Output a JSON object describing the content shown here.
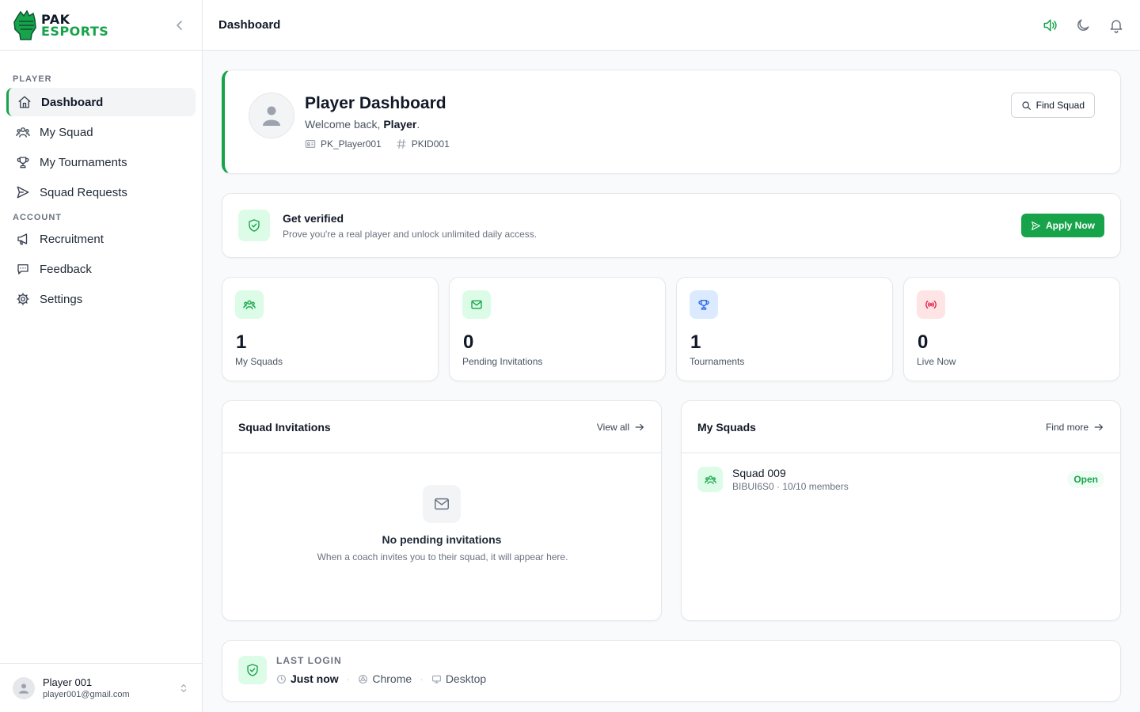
{
  "brand": {
    "line1": "PAK",
    "line2": "ESPORTS",
    "accent": "#16a34a"
  },
  "sidebar": {
    "sections": [
      {
        "label": "PLAYER"
      },
      {
        "label": "ACCOUNT"
      }
    ],
    "items": [
      {
        "label": "Dashboard",
        "icon": "home-icon",
        "active": true
      },
      {
        "label": "My Squad",
        "icon": "users-icon"
      },
      {
        "label": "My Tournaments",
        "icon": "trophy-icon"
      },
      {
        "label": "Squad Requests",
        "icon": "send-icon"
      },
      {
        "label": "Recruitment",
        "icon": "megaphone-icon"
      },
      {
        "label": "Feedback",
        "icon": "message-icon"
      },
      {
        "label": "Settings",
        "icon": "gear-icon"
      }
    ],
    "user": {
      "name": "Player 001",
      "email": "player001@gmail.com"
    }
  },
  "topbar": {
    "title": "Dashboard",
    "icons": [
      "volume-icon",
      "moon-icon",
      "bell-icon"
    ]
  },
  "hero": {
    "title": "Player Dashboard",
    "welcome_prefix": "Welcome back, ",
    "welcome_name": "Player",
    "welcome_suffix": ".",
    "username": "PK_Player001",
    "player_id": "PKID001",
    "find_squad_label": "Find Squad"
  },
  "verify": {
    "title": "Get verified",
    "subtitle": "Prove you're a real player and unlock unlimited daily access.",
    "button_label": "Apply Now"
  },
  "stats": [
    {
      "value": "1",
      "label": "My Squads",
      "icon": "users-icon",
      "color": "#16a34a",
      "bg": "#dcfce7"
    },
    {
      "value": "0",
      "label": "Pending Invitations",
      "icon": "mail-icon",
      "color": "#16a34a",
      "bg": "#dcfce7"
    },
    {
      "value": "1",
      "label": "Tournaments",
      "icon": "trophy-icon",
      "color": "#2563eb",
      "bg": "#dbeafe"
    },
    {
      "value": "0",
      "label": "Live Now",
      "icon": "broadcast-icon",
      "color": "#e11d48",
      "bg": "#ffe4e6"
    }
  ],
  "invitations": {
    "title": "Squad Invitations",
    "link_label": "View all",
    "empty_title": "No pending invitations",
    "empty_subtitle": "When a coach invites you to their squad, it will appear here."
  },
  "my_squads": {
    "title": "My Squads",
    "link_label": "Find more",
    "items": [
      {
        "name": "Squad 009",
        "meta": "BIBUI6S0 · 10/10 members",
        "status": "Open"
      }
    ]
  },
  "last_login": {
    "label": "LAST LOGIN",
    "when": "Just now",
    "browser": "Chrome",
    "device": "Desktop"
  }
}
